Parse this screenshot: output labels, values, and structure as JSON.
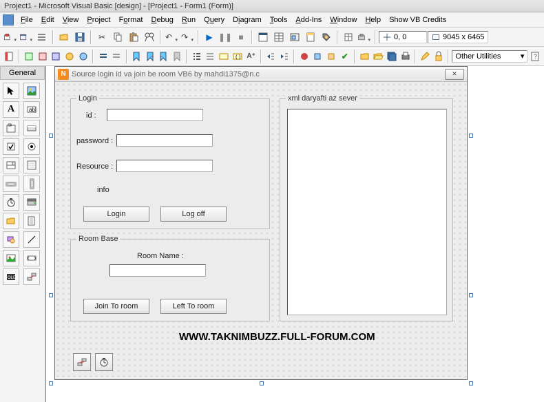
{
  "titlebar": "Project1 - Microsoft Visual Basic [design] - [Project1 - Form1 (Form)]",
  "menu": {
    "file": "File",
    "edit": "Edit",
    "view": "View",
    "project": "Project",
    "format": "Format",
    "debug": "Debug",
    "run": "Run",
    "query": "Query",
    "diagram": "Diagram",
    "tools": "Tools",
    "addins": "Add-Ins",
    "window": "Window",
    "help": "Help",
    "credits": "Show VB Credits"
  },
  "toolbar": {
    "coords": "0, 0",
    "size": "9045 x 6465",
    "other_util": "Other Utilities"
  },
  "toolbox": {
    "tab": "General"
  },
  "form": {
    "title": "Source login id va join be room VB6 by mahdi1375@n.c",
    "login": {
      "legend": "Login",
      "id_label": "id :",
      "password_label": "password :",
      "resource_label": "Resource :",
      "info_label": "info",
      "login_btn": "Login",
      "logoff_btn": "Log off"
    },
    "room": {
      "legend": "Room Base",
      "name_label": "Room Name :",
      "join_btn": "Join To room",
      "left_btn": "Left To room"
    },
    "xml": {
      "legend": "xml daryafti az sever"
    },
    "watermark": "WWW.TAKNIMBUZZ.FULL-FORUM.COM"
  }
}
